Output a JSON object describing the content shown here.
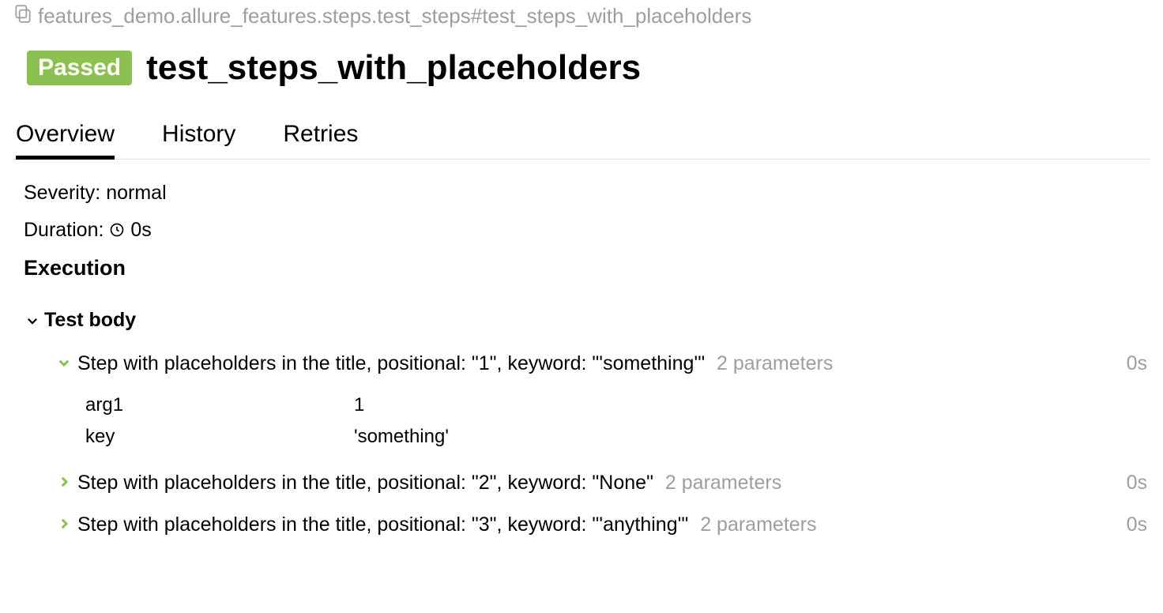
{
  "breadcrumb": "features_demo.allure_features.steps.test_steps#test_steps_with_placeholders",
  "status": "Passed",
  "title": "test_steps_with_placeholders",
  "tabs": [
    "Overview",
    "History",
    "Retries"
  ],
  "active_tab": 0,
  "severity": {
    "label": "Severity:",
    "value": "normal"
  },
  "duration": {
    "label": "Duration:",
    "value": "0s"
  },
  "execution_heading": "Execution",
  "test_body_label": "Test body",
  "steps": [
    {
      "expanded": true,
      "title": "Step with placeholders in the title, positional: \"1\", keyword: \"'something'\"",
      "params_badge": "2 parameters",
      "duration": "0s",
      "params": [
        {
          "name": "arg1",
          "value": "1"
        },
        {
          "name": "key",
          "value": "'something'"
        }
      ]
    },
    {
      "expanded": false,
      "title": "Step with placeholders in the title, positional: \"2\", keyword: \"None\"",
      "params_badge": "2 parameters",
      "duration": "0s"
    },
    {
      "expanded": false,
      "title": "Step with placeholders in the title, positional: \"3\", keyword: \"'anything'\"",
      "params_badge": "2 parameters",
      "duration": "0s"
    }
  ]
}
